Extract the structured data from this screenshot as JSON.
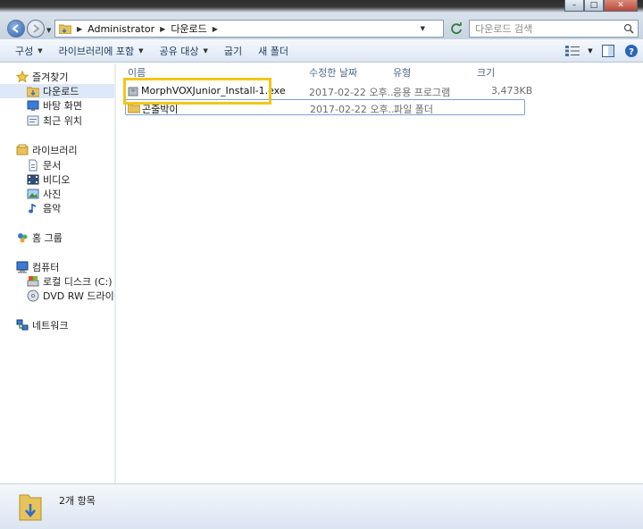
{
  "window": {
    "min": "–",
    "max": "□",
    "close": "✕"
  },
  "address": {
    "crumbs": [
      "Administrator",
      "다운로드"
    ]
  },
  "search": {
    "placeholder": "다운로드 검색"
  },
  "toolbar": {
    "organize": "구성",
    "include_library": "라이브러리에 포함",
    "share_with": "공유 대상",
    "burn": "굽기",
    "new_folder": "새 폴더"
  },
  "navpane": {
    "favorites": {
      "label": "즐겨찾기",
      "items": [
        "다운로드",
        "바탕 화면",
        "최근 위치"
      ]
    },
    "libraries": {
      "label": "라이브러리",
      "items": [
        "문서",
        "비디오",
        "사진",
        "음악"
      ]
    },
    "homegroup": "홈 그룹",
    "computer": {
      "label": "컴퓨터",
      "items": [
        "로컬 디스크 (C:)",
        "DVD RW 드라이브 ("
      ]
    },
    "network": "네트워크"
  },
  "columns": {
    "name": "이름",
    "date": "수정한 날짜",
    "type": "유형",
    "size": "크기"
  },
  "files": [
    {
      "name": "MorphVOXJunior_Install-1.exe",
      "date": "2017-02-22 오후...",
      "type": "응용 프로그램",
      "size": "3,473KB",
      "icon": "exe-icon"
    },
    {
      "name": "곤줄박이",
      "date": "2017-02-22 오후...",
      "type": "파일 폴더",
      "size": "",
      "icon": "folder-icon"
    }
  ],
  "status": {
    "item_count": "2개 항목"
  },
  "colors": {
    "highlight": "#f5c518",
    "selection": "#dde9f8",
    "accent": "#2e5fa8"
  }
}
